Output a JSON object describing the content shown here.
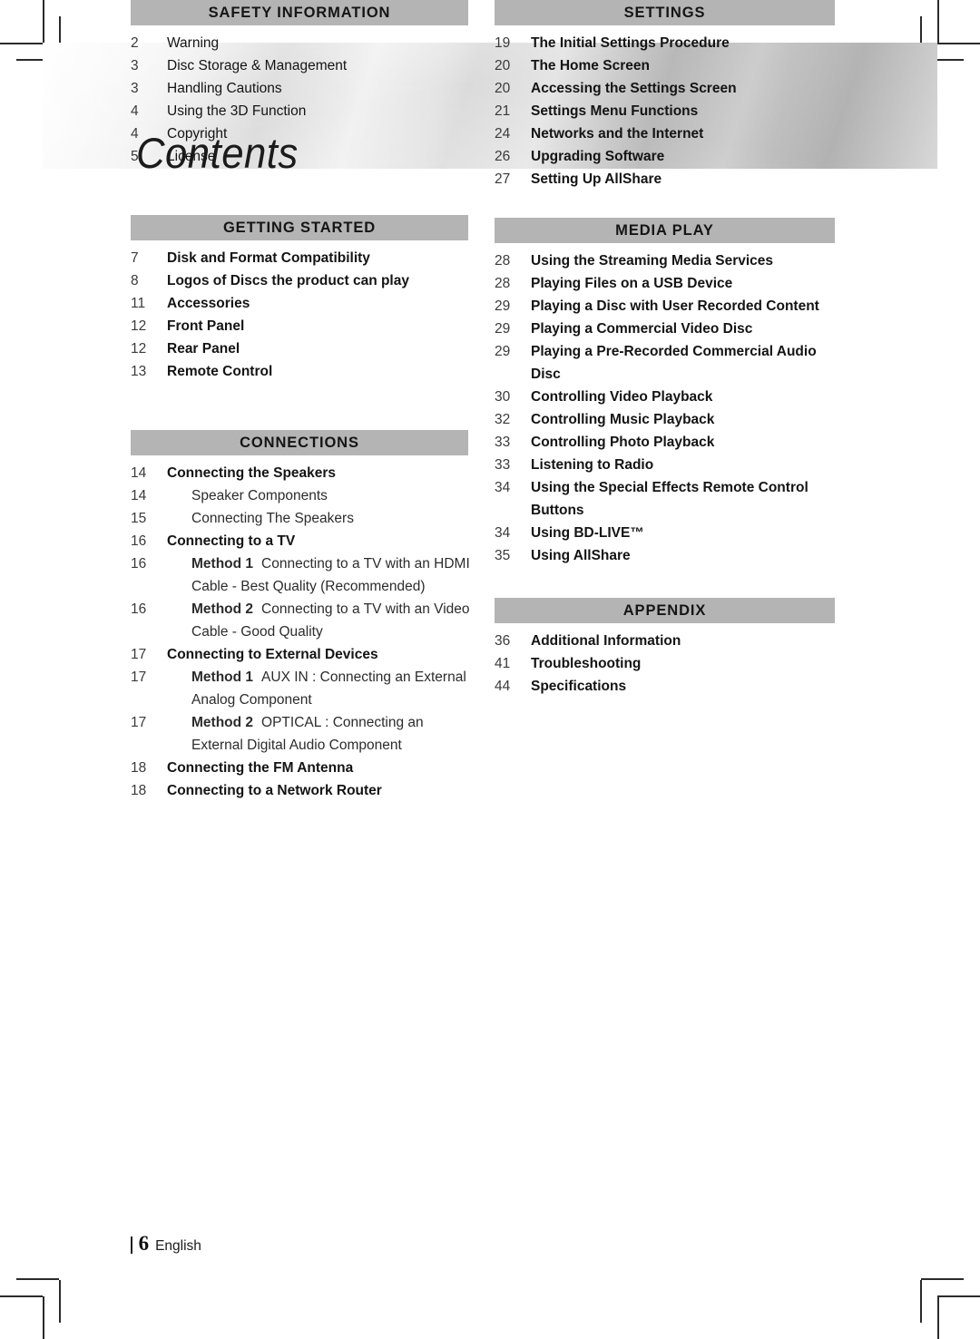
{
  "banner": {
    "title": "Contents"
  },
  "footer": {
    "page_number": "6",
    "language": "English"
  },
  "columns": [
    {
      "id": "left",
      "sections": [
        {
          "header": "SAFETY INFORMATION",
          "entries": [
            {
              "page": "2",
              "title": "Warning",
              "level": 1,
              "weight": "normal"
            },
            {
              "page": "3",
              "title": "Disc Storage & Management",
              "level": 1,
              "weight": "normal"
            },
            {
              "page": "3",
              "title": "Handling Cautions",
              "level": 1,
              "weight": "normal"
            },
            {
              "page": "4",
              "title": "Using the 3D Function",
              "level": 1,
              "weight": "normal"
            },
            {
              "page": "4",
              "title": "Copyright",
              "level": 1,
              "weight": "normal"
            },
            {
              "page": "5",
              "title": "License",
              "level": 1,
              "weight": "normal"
            }
          ]
        },
        {
          "header": "GETTING STARTED",
          "entries": [
            {
              "page": "7",
              "title": "Disk and Format Compatibility",
              "level": 1,
              "weight": "bold"
            },
            {
              "page": "8",
              "title": "Logos of Discs the product can play",
              "level": 1,
              "weight": "bold"
            },
            {
              "page": "11",
              "title": "Accessories",
              "level": 1,
              "weight": "bold"
            },
            {
              "page": "12",
              "title": "Front Panel",
              "level": 1,
              "weight": "bold"
            },
            {
              "page": "12",
              "title": "Rear Panel",
              "level": 1,
              "weight": "bold"
            },
            {
              "page": "13",
              "title": "Remote Control",
              "level": 1,
              "weight": "bold"
            }
          ]
        },
        {
          "header": "CONNECTIONS",
          "entries": [
            {
              "page": "14",
              "title": "Connecting the Speakers",
              "level": 1,
              "weight": "bold"
            },
            {
              "page": "14",
              "title": "Speaker Components",
              "level": 2,
              "weight": "light"
            },
            {
              "page": "15",
              "title": "Connecting The Speakers",
              "level": 2,
              "weight": "light"
            },
            {
              "page": "16",
              "title": "Connecting to a TV",
              "level": 1,
              "weight": "bold"
            },
            {
              "page": "16",
              "lead": "Method 1",
              "rest": "Connecting to a TV with an HDMI Cable - Best Quality (Recommended)",
              "level": 2,
              "weight": "light"
            },
            {
              "page": "16",
              "lead": "Method 2",
              "rest": "Connecting to a TV with an Video Cable - Good Quality",
              "level": 2,
              "weight": "light"
            },
            {
              "page": "17",
              "title": "Connecting to External Devices",
              "level": 1,
              "weight": "bold"
            },
            {
              "page": "17",
              "lead": "Method 1",
              "rest": "AUX IN : Connecting an External Analog Component",
              "level": 2,
              "weight": "light"
            },
            {
              "page": "17",
              "lead": "Method 2",
              "rest": "OPTICAL : Connecting an External Digital Audio Component",
              "level": 2,
              "weight": "light"
            },
            {
              "page": "18",
              "title": "Connecting the FM Antenna",
              "level": 1,
              "weight": "bold"
            },
            {
              "page": "18",
              "title": "Connecting to a Network Router",
              "level": 1,
              "weight": "bold"
            }
          ]
        }
      ]
    },
    {
      "id": "right",
      "sections": [
        {
          "header": "SETTINGS",
          "entries": [
            {
              "page": "19",
              "title": "The Initial Settings Procedure",
              "level": 1,
              "weight": "bold"
            },
            {
              "page": "20",
              "title": "The Home Screen",
              "level": 1,
              "weight": "bold"
            },
            {
              "page": "20",
              "title": "Accessing the Settings Screen",
              "level": 1,
              "weight": "bold"
            },
            {
              "page": "21",
              "title": "Settings Menu Functions",
              "level": 1,
              "weight": "bold"
            },
            {
              "page": "24",
              "title": "Networks and the Internet",
              "level": 1,
              "weight": "bold"
            },
            {
              "page": "26",
              "title": "Upgrading Software",
              "level": 1,
              "weight": "bold"
            },
            {
              "page": "27",
              "title": "Setting Up AllShare",
              "level": 1,
              "weight": "bold"
            }
          ]
        },
        {
          "header": "MEDIA PLAY",
          "entries": [
            {
              "page": "28",
              "title": "Using the Streaming Media Services",
              "level": 1,
              "weight": "bold"
            },
            {
              "page": "28",
              "title": "Playing Files on a USB Device",
              "level": 1,
              "weight": "bold"
            },
            {
              "page": "29",
              "title": "Playing a Disc with User Recorded Content",
              "level": 1,
              "weight": "bold"
            },
            {
              "page": "29",
              "title": "Playing a Commercial Video Disc",
              "level": 1,
              "weight": "bold"
            },
            {
              "page": "29",
              "title": "Playing a Pre-Recorded Commercial Audio Disc",
              "level": 1,
              "weight": "bold"
            },
            {
              "page": "30",
              "title": "Controlling Video Playback",
              "level": 1,
              "weight": "bold"
            },
            {
              "page": "32",
              "title": "Controlling Music Playback",
              "level": 1,
              "weight": "bold"
            },
            {
              "page": "33",
              "title": "Controlling Photo Playback",
              "level": 1,
              "weight": "bold"
            },
            {
              "page": "33",
              "title": "Listening to Radio",
              "level": 1,
              "weight": "bold"
            },
            {
              "page": "34",
              "title": "Using the Special Effects Remote Control Buttons",
              "level": 1,
              "weight": "bold"
            },
            {
              "page": "34",
              "title": "Using BD-LIVE™",
              "level": 1,
              "weight": "bold"
            },
            {
              "page": "35",
              "title": "Using AllShare",
              "level": 1,
              "weight": "bold"
            }
          ]
        },
        {
          "header": "APPENDIX",
          "entries": [
            {
              "page": "36",
              "title": "Additional Information",
              "level": 1,
              "weight": "bold"
            },
            {
              "page": "41",
              "title": "Troubleshooting",
              "level": 1,
              "weight": "bold"
            },
            {
              "page": "44",
              "title": "Specifications",
              "level": 1,
              "weight": "bold"
            }
          ]
        }
      ]
    }
  ]
}
